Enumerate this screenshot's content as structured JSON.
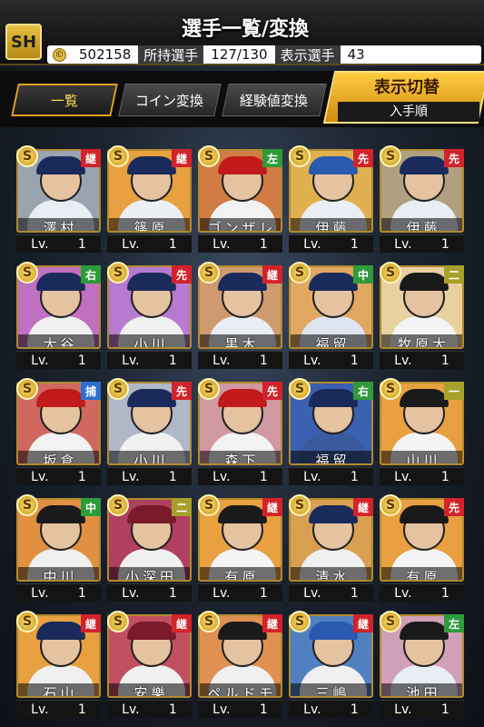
{
  "header": {
    "title": "選手一覧/変換",
    "logo_text": "SH",
    "coin_value": "502158",
    "owned_label": "所持選手",
    "owned_value": "127/130",
    "display_label": "表示選手",
    "display_value": "43"
  },
  "tabs": [
    "一覧",
    "コイン変換",
    "経験値変換"
  ],
  "switch": {
    "label": "表示切替",
    "sub": "入手順"
  },
  "badge_letter": "S",
  "level_prefix": "Lv.",
  "colors": {
    "red": "#d2232a",
    "green": "#2e9a3a",
    "blue": "#2a6fd0",
    "olive": "#a7a02a"
  },
  "cards": [
    {
      "name": "澤村",
      "pos": "継",
      "level": "1",
      "pos_color": "#d2232a",
      "bg": "#9aa4b0",
      "cap": "#1a2a5a",
      "body": "#e8eef4"
    },
    {
      "name": "篠原",
      "pos": "継",
      "level": "1",
      "pos_color": "#d2232a",
      "bg": "#e8a040",
      "cap": "#1a2a5a",
      "body": "#ecf0f4"
    },
    {
      "name": "ゴンザレス",
      "pos": "左",
      "level": "1",
      "pos_color": "#2e9a3a",
      "bg": "#d07c44",
      "cap": "#c01a1a",
      "body": "#f2f2f2"
    },
    {
      "name": "伊藤",
      "pos": "先",
      "level": "1",
      "pos_color": "#d2232a",
      "bg": "#e0b050",
      "cap": "#2a5ab0",
      "body": "#e8eef4"
    },
    {
      "name": "伊藤",
      "pos": "先",
      "level": "1",
      "pos_color": "#d2232a",
      "bg": "#b0a080",
      "cap": "#1a2a5a",
      "body": "#e8eef4"
    },
    {
      "name": "大谷",
      "pos": "右",
      "level": "1",
      "pos_color": "#2e9a3a",
      "bg": "#c070c0",
      "cap": "#1a2a5a",
      "body": "#f0f0f0"
    },
    {
      "name": "小川",
      "pos": "先",
      "level": "1",
      "pos_color": "#d2232a",
      "bg": "#b87ad0",
      "cap": "#1a2a5a",
      "body": "#f0f0f0"
    },
    {
      "name": "黒木",
      "pos": "継",
      "level": "1",
      "pos_color": "#d2232a",
      "bg": "#d09a70",
      "cap": "#1a2a5a",
      "body": "#e8eef4"
    },
    {
      "name": "福留",
      "pos": "中",
      "level": "1",
      "pos_color": "#2e9a3a",
      "bg": "#e0a860",
      "cap": "#1a2a5a",
      "body": "#dde4f0"
    },
    {
      "name": "牧原大",
      "pos": "二",
      "level": "1",
      "pos_color": "#a7a02a",
      "bg": "#e8d0a0",
      "cap": "#1a1a1a",
      "body": "#f4f4f4"
    },
    {
      "name": "坂倉",
      "pos": "捕",
      "level": "1",
      "pos_color": "#2a6fd0",
      "bg": "#d06860",
      "cap": "#c01a1a",
      "body": "#f2f2f2"
    },
    {
      "name": "小川",
      "pos": "先",
      "level": "1",
      "pos_color": "#d2232a",
      "bg": "#b0b8c8",
      "cap": "#1a2a5a",
      "body": "#f0f0f0"
    },
    {
      "name": "森下",
      "pos": "先",
      "level": "1",
      "pos_color": "#d2232a",
      "bg": "#d098a0",
      "cap": "#c01a1a",
      "body": "#f2f2f2"
    },
    {
      "name": "福留",
      "pos": "右",
      "level": "1",
      "pos_color": "#2e9a3a",
      "bg": "#3a60b0",
      "cap": "#1a2a5a",
      "body": "#3a5aa0"
    },
    {
      "name": "山川",
      "pos": "一",
      "level": "1",
      "pos_color": "#a7a02a",
      "bg": "#e8a040",
      "cap": "#1a1a1a",
      "body": "#f4f4f4"
    },
    {
      "name": "中川",
      "pos": "中",
      "level": "1",
      "pos_color": "#2e9a3a",
      "bg": "#e09040",
      "cap": "#1a1a1a",
      "body": "#f0f0f0"
    },
    {
      "name": "小深田",
      "pos": "二",
      "level": "1",
      "pos_color": "#a7a02a",
      "bg": "#b04060",
      "cap": "#7a1a2a",
      "body": "#f0f0f0"
    },
    {
      "name": "有原",
      "pos": "継",
      "level": "1",
      "pos_color": "#d2232a",
      "bg": "#e8a040",
      "cap": "#1a1a1a",
      "body": "#f4f4f4"
    },
    {
      "name": "清水",
      "pos": "継",
      "level": "1",
      "pos_color": "#d2232a",
      "bg": "#d8a050",
      "cap": "#1a2a5a",
      "body": "#f0f0f0"
    },
    {
      "name": "有原",
      "pos": "先",
      "level": "1",
      "pos_color": "#d2232a",
      "bg": "#e8a040",
      "cap": "#1a1a1a",
      "body": "#f4f4f4"
    },
    {
      "name": "石山",
      "pos": "継",
      "level": "1",
      "pos_color": "#d2232a",
      "bg": "#e8a040",
      "cap": "#1a2a5a",
      "body": "#f0f0f0"
    },
    {
      "name": "安樂",
      "pos": "継",
      "level": "1",
      "pos_color": "#d2232a",
      "bg": "#c05060",
      "cap": "#7a1a2a",
      "body": "#f0f0f0"
    },
    {
      "name": "ペルドモ",
      "pos": "継",
      "level": "1",
      "pos_color": "#d2232a",
      "bg": "#e09050",
      "cap": "#1a1a1a",
      "body": "#f0f0f0"
    },
    {
      "name": "三嶋",
      "pos": "継",
      "level": "1",
      "pos_color": "#d2232a",
      "bg": "#5080c0",
      "cap": "#2a5ab0",
      "body": "#f0f0f0"
    },
    {
      "name": "池田",
      "pos": "左",
      "level": "1",
      "pos_color": "#2e9a3a",
      "bg": "#d0a0b8",
      "cap": "#1a1a1a",
      "body": "#e8eef4"
    }
  ]
}
